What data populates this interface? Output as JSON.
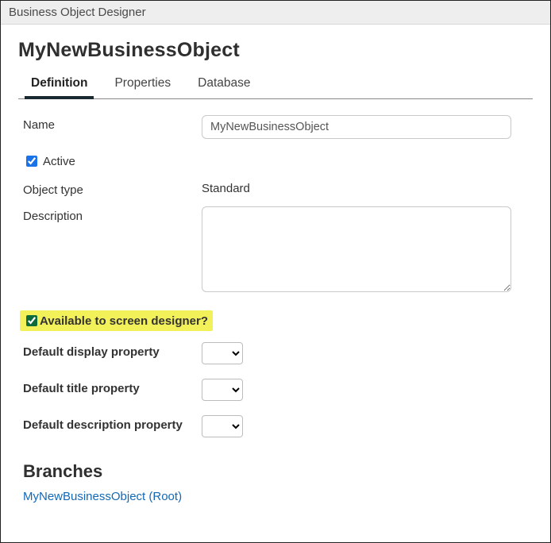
{
  "window": {
    "title": "Business Object Designer"
  },
  "page": {
    "title": "MyNewBusinessObject"
  },
  "tabs": {
    "definition": "Definition",
    "properties": "Properties",
    "database": "Database"
  },
  "form": {
    "name_label": "Name",
    "name_value": "MyNewBusinessObject",
    "active_label": "Active",
    "object_type_label": "Object type",
    "object_type_value": "Standard",
    "description_label": "Description",
    "description_value": "",
    "available_label": "Available to screen designer?",
    "default_display_label": "Default display property",
    "default_title_label": "Default title property",
    "default_description_label": "Default description property"
  },
  "branches": {
    "heading": "Branches",
    "root_link": "MyNewBusinessObject (Root)"
  }
}
